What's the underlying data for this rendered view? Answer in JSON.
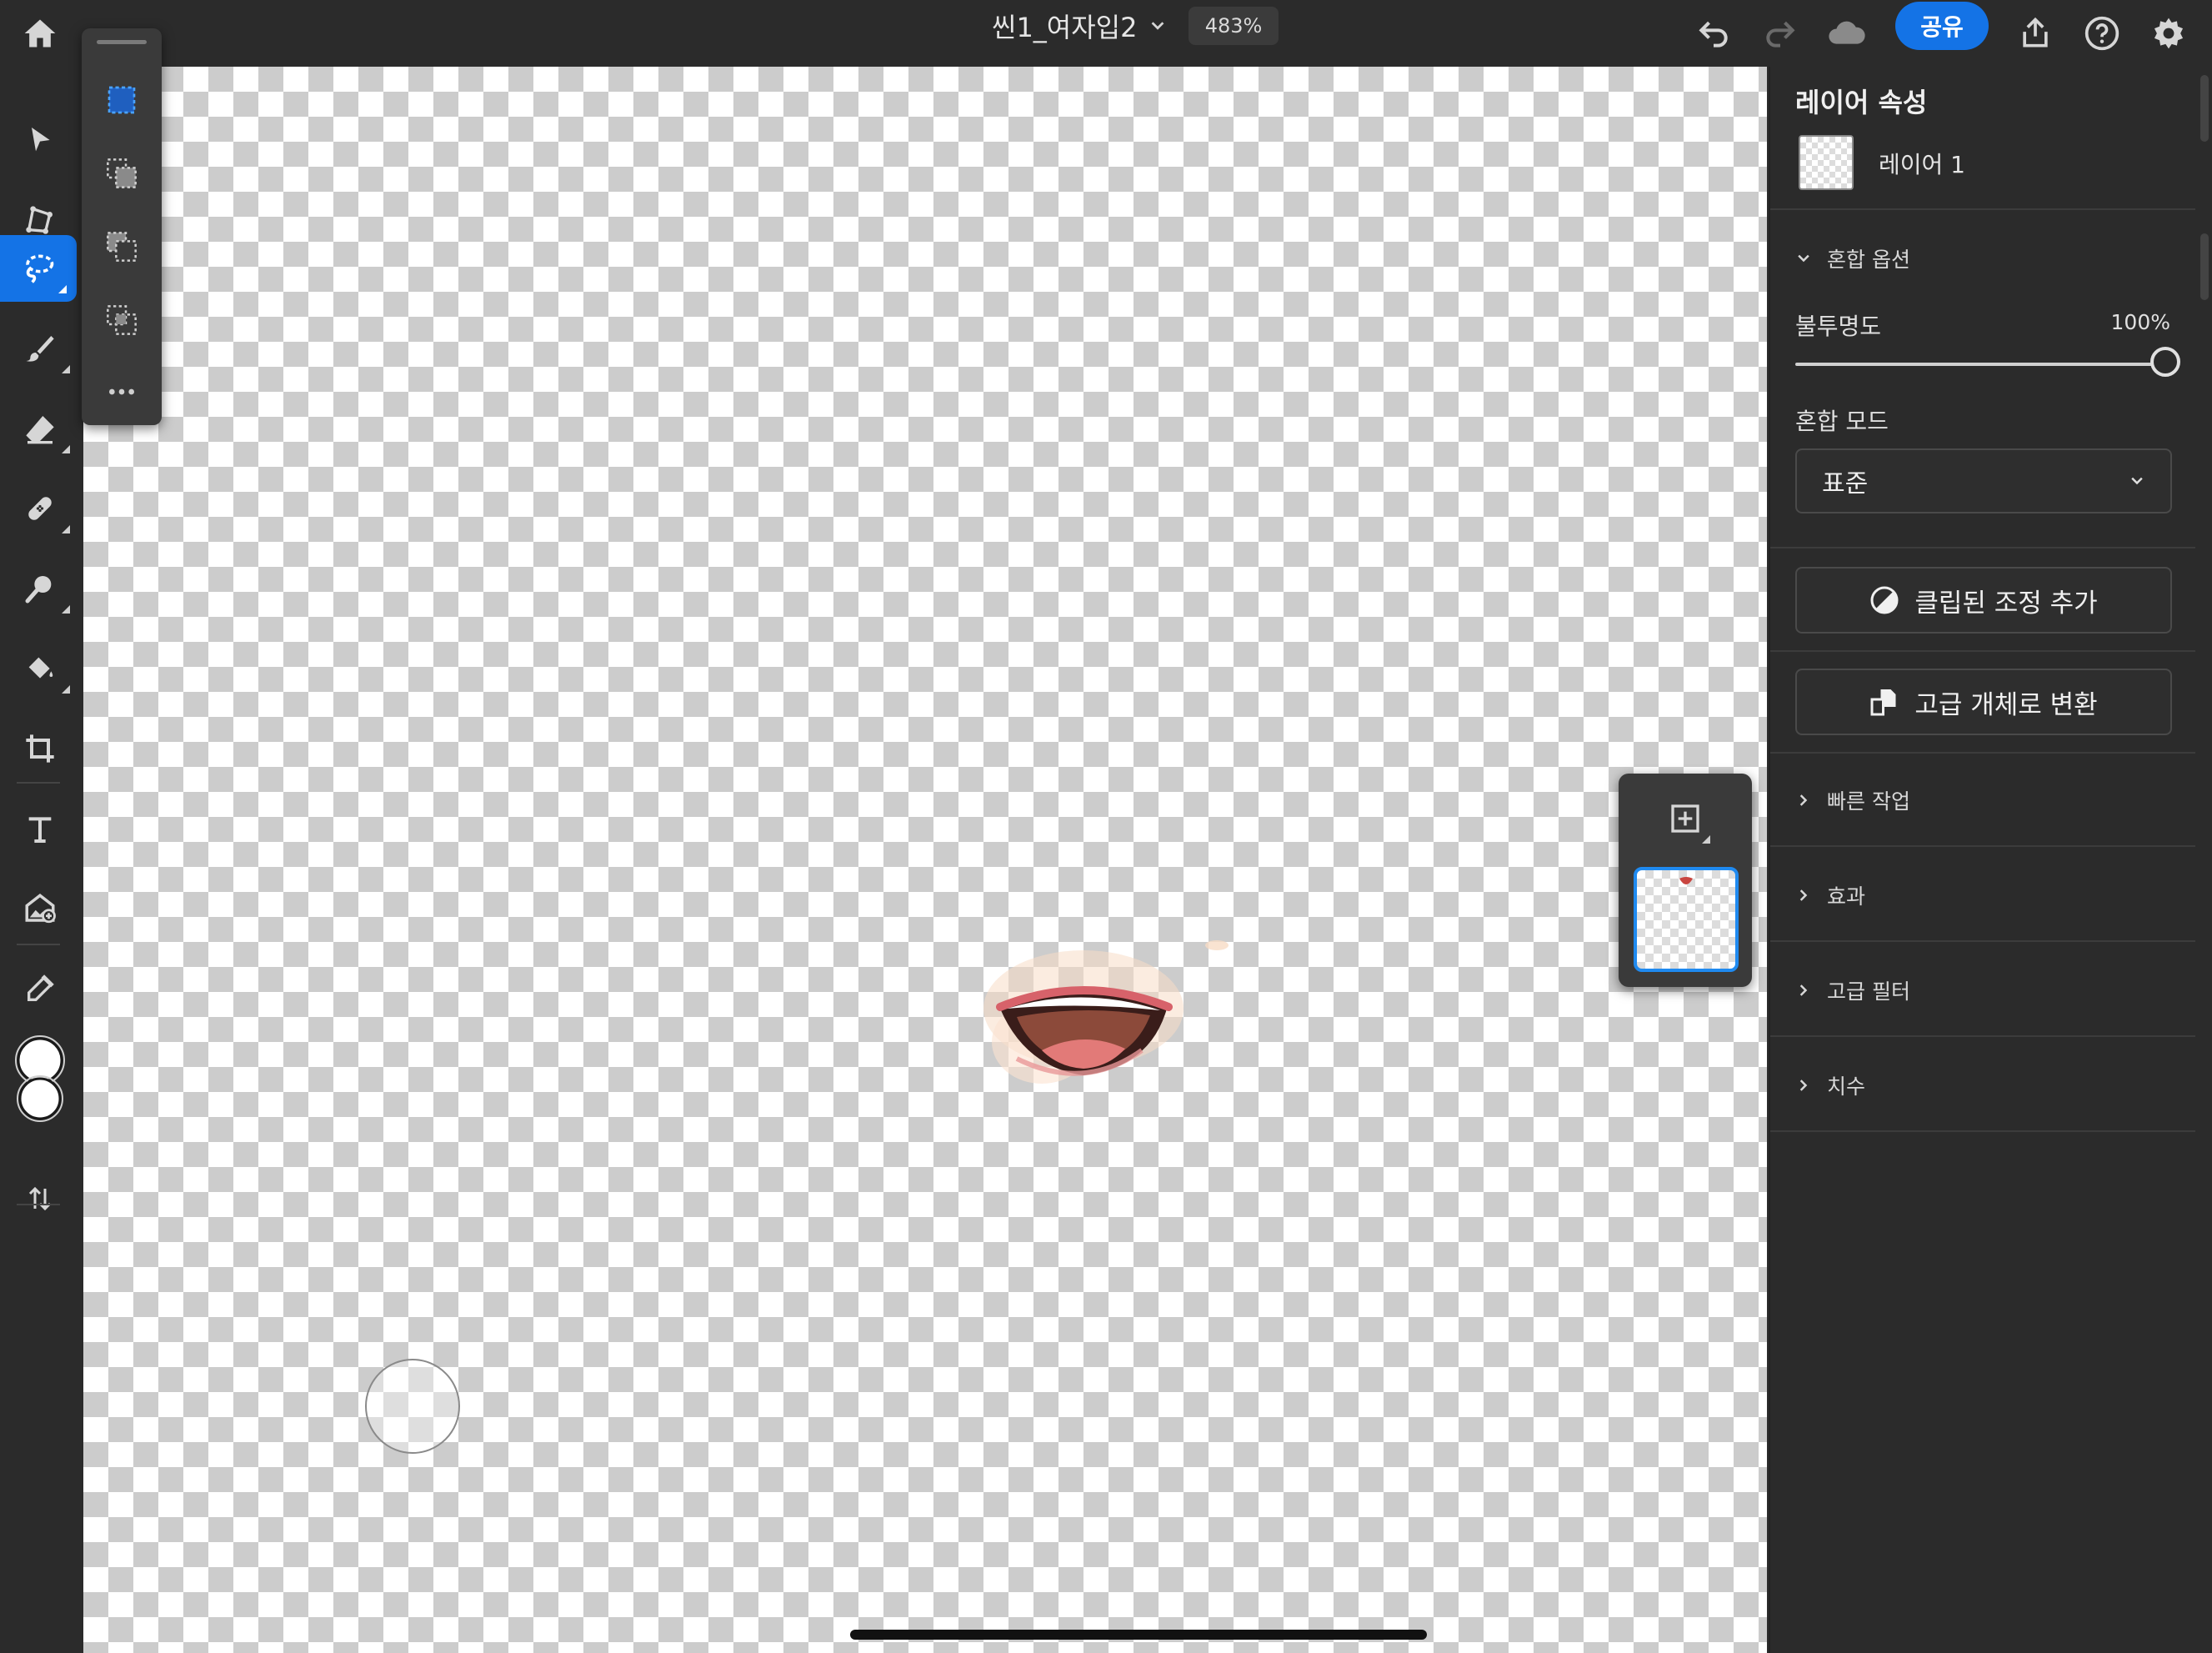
{
  "header": {
    "title": "씬1_여자입2",
    "zoom": "483%",
    "share_label": "공유"
  },
  "properties": {
    "title": "레이어 속성",
    "layer_name": "레이어 1",
    "blend_options_label": "혼합 옵션",
    "opacity_label": "불투명도",
    "opacity_value": "100%",
    "opacity_fraction": 1.0,
    "blend_mode_label": "혼합 모드",
    "blend_mode_value": "표준",
    "clipped_adjustment_label": "클립된 조정 추가",
    "smart_object_label": "고급 개체로 변환",
    "sections": {
      "quick_actions": "빠른 작업",
      "effects": "효과",
      "smart_filters": "고급 필터",
      "dimensions": "치수"
    }
  },
  "colors": {
    "accent": "#1473e6",
    "background": "#2b2b2b",
    "panel": "#3a3a3a"
  },
  "icons": {
    "home": "home-icon",
    "undo": "undo-icon",
    "redo": "redo-icon",
    "cloud": "cloud-icon",
    "export": "export-icon",
    "help": "help-icon",
    "settings": "gear-icon"
  }
}
